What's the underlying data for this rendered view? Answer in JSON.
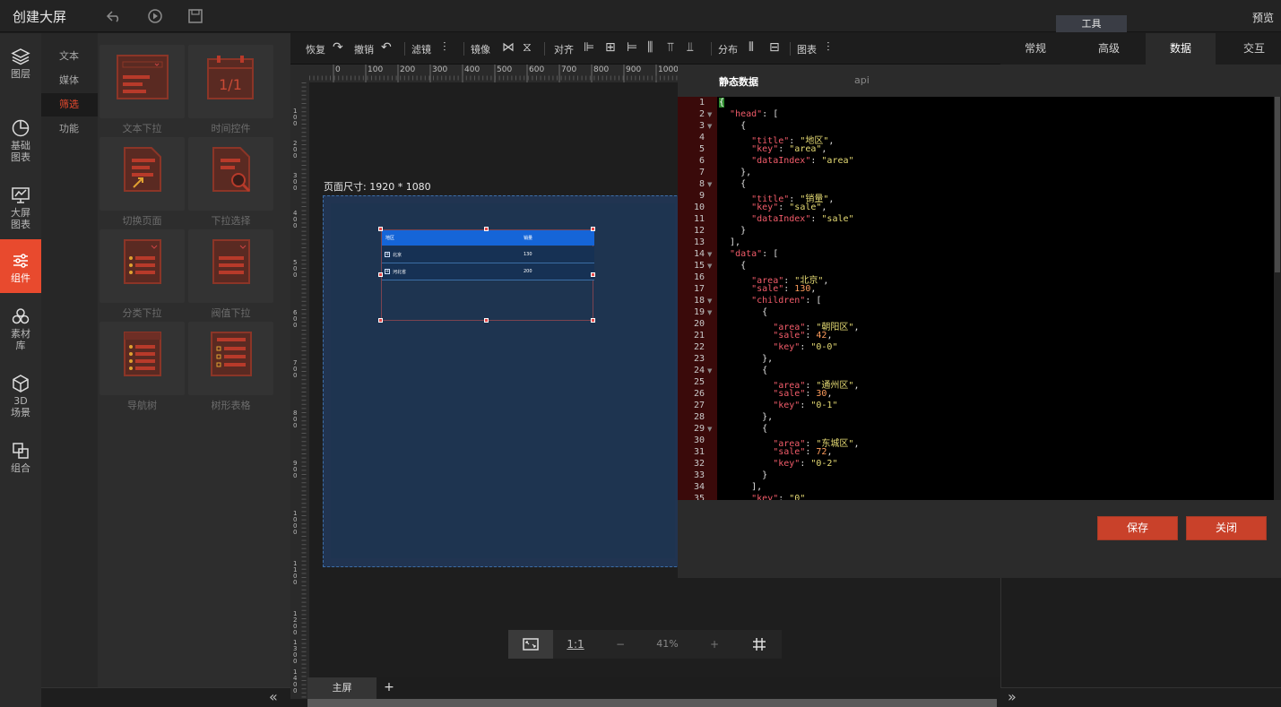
{
  "app": {
    "title": "创建大屏",
    "tools_tab": "工具",
    "preview": "预览"
  },
  "left_nav": [
    {
      "label": "图层",
      "icon": "layers-icon"
    },
    {
      "label": "基础图表",
      "icon": "pie-chart-icon"
    },
    {
      "label": "大屏图表",
      "icon": "screen-chart-icon"
    },
    {
      "label": "组件",
      "icon": "sliders-icon",
      "active": true
    },
    {
      "label": "素材库",
      "icon": "materials-icon"
    },
    {
      "label": "3D场景",
      "icon": "cube-icon"
    },
    {
      "label": "组合",
      "icon": "group-icon"
    }
  ],
  "sub_nav": [
    {
      "label": "文本"
    },
    {
      "label": "媒体"
    },
    {
      "label": "筛选",
      "active": true
    },
    {
      "label": "功能"
    }
  ],
  "components": [
    {
      "label": "文本下拉"
    },
    {
      "label": "时间控件",
      "icon_text": "1/1"
    },
    {
      "label": "切换页面"
    },
    {
      "label": "下拉选择"
    },
    {
      "label": "分类下拉"
    },
    {
      "label": "阀值下拉"
    },
    {
      "label": "导航树"
    },
    {
      "label": "树形表格"
    }
  ],
  "toolbar": {
    "redo": "恢复",
    "undo": "撤销",
    "filter": "滤镜",
    "mirror": "镜像",
    "align": "对齐",
    "distribute": "分布",
    "chart": "图表"
  },
  "ruler": {
    "h_labels": [
      "0",
      "100",
      "200",
      "300",
      "400",
      "500",
      "600",
      "700",
      "800",
      "900",
      "1000"
    ],
    "v_labels": [
      "100",
      "200",
      "300",
      "400",
      "500",
      "600",
      "700",
      "800",
      "900",
      "1000",
      "1100",
      "1200",
      "1300",
      "1400"
    ]
  },
  "canvas": {
    "page_size": "页面尺寸: 1920 * 1080",
    "table": {
      "headers": [
        "地区",
        "销量"
      ],
      "rows": [
        {
          "area": "北京",
          "sale": "130"
        },
        {
          "area": "河北省",
          "sale": "200"
        }
      ]
    }
  },
  "zoom": {
    "fit_icon": "fit-screen-icon",
    "one_to_one": "1:1",
    "minus": "−",
    "level": "41%",
    "plus": "+",
    "grid_icon": "grid-icon"
  },
  "pages": {
    "main": "主屏",
    "add": "+"
  },
  "right_tabs": [
    {
      "label": "常规"
    },
    {
      "label": "高级"
    },
    {
      "label": "数据",
      "active": true
    },
    {
      "label": "交互"
    }
  ],
  "data_modal": {
    "tab_static": "静态数据",
    "tab_api": "api",
    "line_numbers": [
      "1",
      "2",
      "3",
      "4",
      "5",
      "6",
      "7",
      "8",
      "9",
      "10",
      "11",
      "12",
      "13",
      "14",
      "15",
      "16",
      "17",
      "18",
      "19",
      "20",
      "21",
      "22",
      "23",
      "24",
      "25",
      "26",
      "27",
      "28",
      "29",
      "30",
      "31",
      "32",
      "33",
      "34",
      "35"
    ],
    "code_lines": [
      "{",
      "  \"head\": [",
      "    {",
      "      \"title\": \"地区\",",
      "      \"key\": \"area\",",
      "      \"dataIndex\": \"area\"",
      "    },",
      "    {",
      "      \"title\": \"销量\",",
      "      \"key\": \"sale\",",
      "      \"dataIndex\": \"sale\"",
      "    }",
      "  ],",
      "  \"data\": [",
      "    {",
      "      \"area\": \"北京\",",
      "      \"sale\": 130,",
      "      \"children\": [",
      "        {",
      "          \"area\": \"朝阳区\",",
      "          \"sale\": 42,",
      "          \"key\": \"0-0\"",
      "        },",
      "        {",
      "          \"area\": \"通州区\",",
      "          \"sale\": 30,",
      "          \"key\": \"0-1\"",
      "        },",
      "        {",
      "          \"area\": \"东城区\",",
      "          \"sale\": 72,",
      "          \"key\": \"0-2\"",
      "        }",
      "      ],",
      "      \"key\": \"0\""
    ],
    "save": "保存",
    "close": "关闭"
  },
  "colors": {
    "accent": "#e84a2e",
    "table_header": "#1565d8",
    "button": "#c9412a"
  }
}
